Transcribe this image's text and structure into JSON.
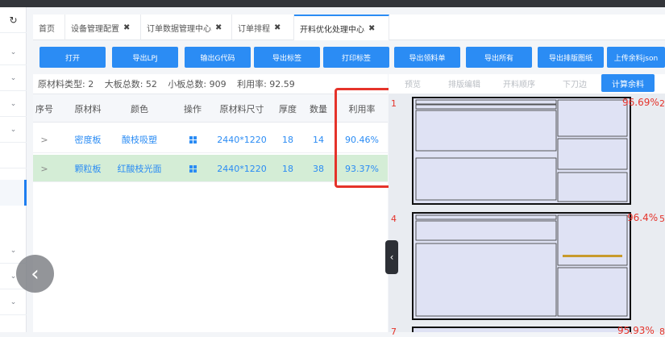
{
  "leftnav": {
    "refresh_icon": "refresh-icon",
    "items": [
      {
        "icon": "chevron-down-icon",
        "glyph": "⌄"
      },
      {
        "icon": "chevron-down-icon",
        "glyph": "⌄"
      },
      {
        "icon": "chevron-down-icon",
        "glyph": "⌄"
      },
      {
        "icon": "chevron-down-icon",
        "glyph": "⌄"
      },
      {
        "icon": "chevron-down-icon",
        "glyph": "⌄"
      },
      {
        "icon": "chevron-down-icon",
        "glyph": "⌄"
      },
      {
        "icon": "chevron-down-icon",
        "glyph": "⌄"
      }
    ]
  },
  "tabs": [
    {
      "label": "首页",
      "closable": false
    },
    {
      "label": "设备管理配置",
      "closable": true
    },
    {
      "label": "订单数据管理中心",
      "closable": true
    },
    {
      "label": "订单排程",
      "closable": true
    },
    {
      "label": "开料优化处理中心",
      "closable": true,
      "active": true
    }
  ],
  "toolbar": {
    "buttons": [
      "打开",
      "导出LPJ",
      "输出G代码",
      "导出标签",
      "打印标签",
      "导出领料单",
      "导出所有",
      "导出排版图纸",
      "上传余料json"
    ]
  },
  "summary": {
    "material_types": "原材料类型: 2",
    "large_total": "大板总数: 52",
    "small_total": "小板总数: 909",
    "utilization": "利用率: 92.59"
  },
  "table": {
    "headers": [
      "序号",
      "原材料",
      "颜色",
      "操作",
      "原材料尺寸",
      "厚度",
      "数量",
      "利用率"
    ],
    "rows": [
      {
        "expand": ">",
        "material": "密度板",
        "color": "酸枝吸塑",
        "size": "2440*1220",
        "thickness": "18",
        "qty": "14",
        "rate": "90.46%"
      },
      {
        "expand": ">",
        "material": "颗粒板",
        "color": "红酸枝光面",
        "size": "2440*1220",
        "thickness": "18",
        "qty": "38",
        "rate": "93.37%",
        "selected": true
      }
    ]
  },
  "subtabs": [
    "预览",
    "排版编辑",
    "开料顺序",
    "下刀边",
    "计算余料"
  ],
  "layout_sheets": [
    {
      "index": "1",
      "rate": "96.69%",
      "next": "2"
    },
    {
      "index": "4",
      "rate": "96.4%",
      "next": "5"
    },
    {
      "index": "7",
      "rate": "95.93%",
      "next": "8"
    }
  ],
  "colors": {
    "accent": "#2b8cf4",
    "highlight": "#e5332a",
    "selected_row": "#d4edd6"
  }
}
